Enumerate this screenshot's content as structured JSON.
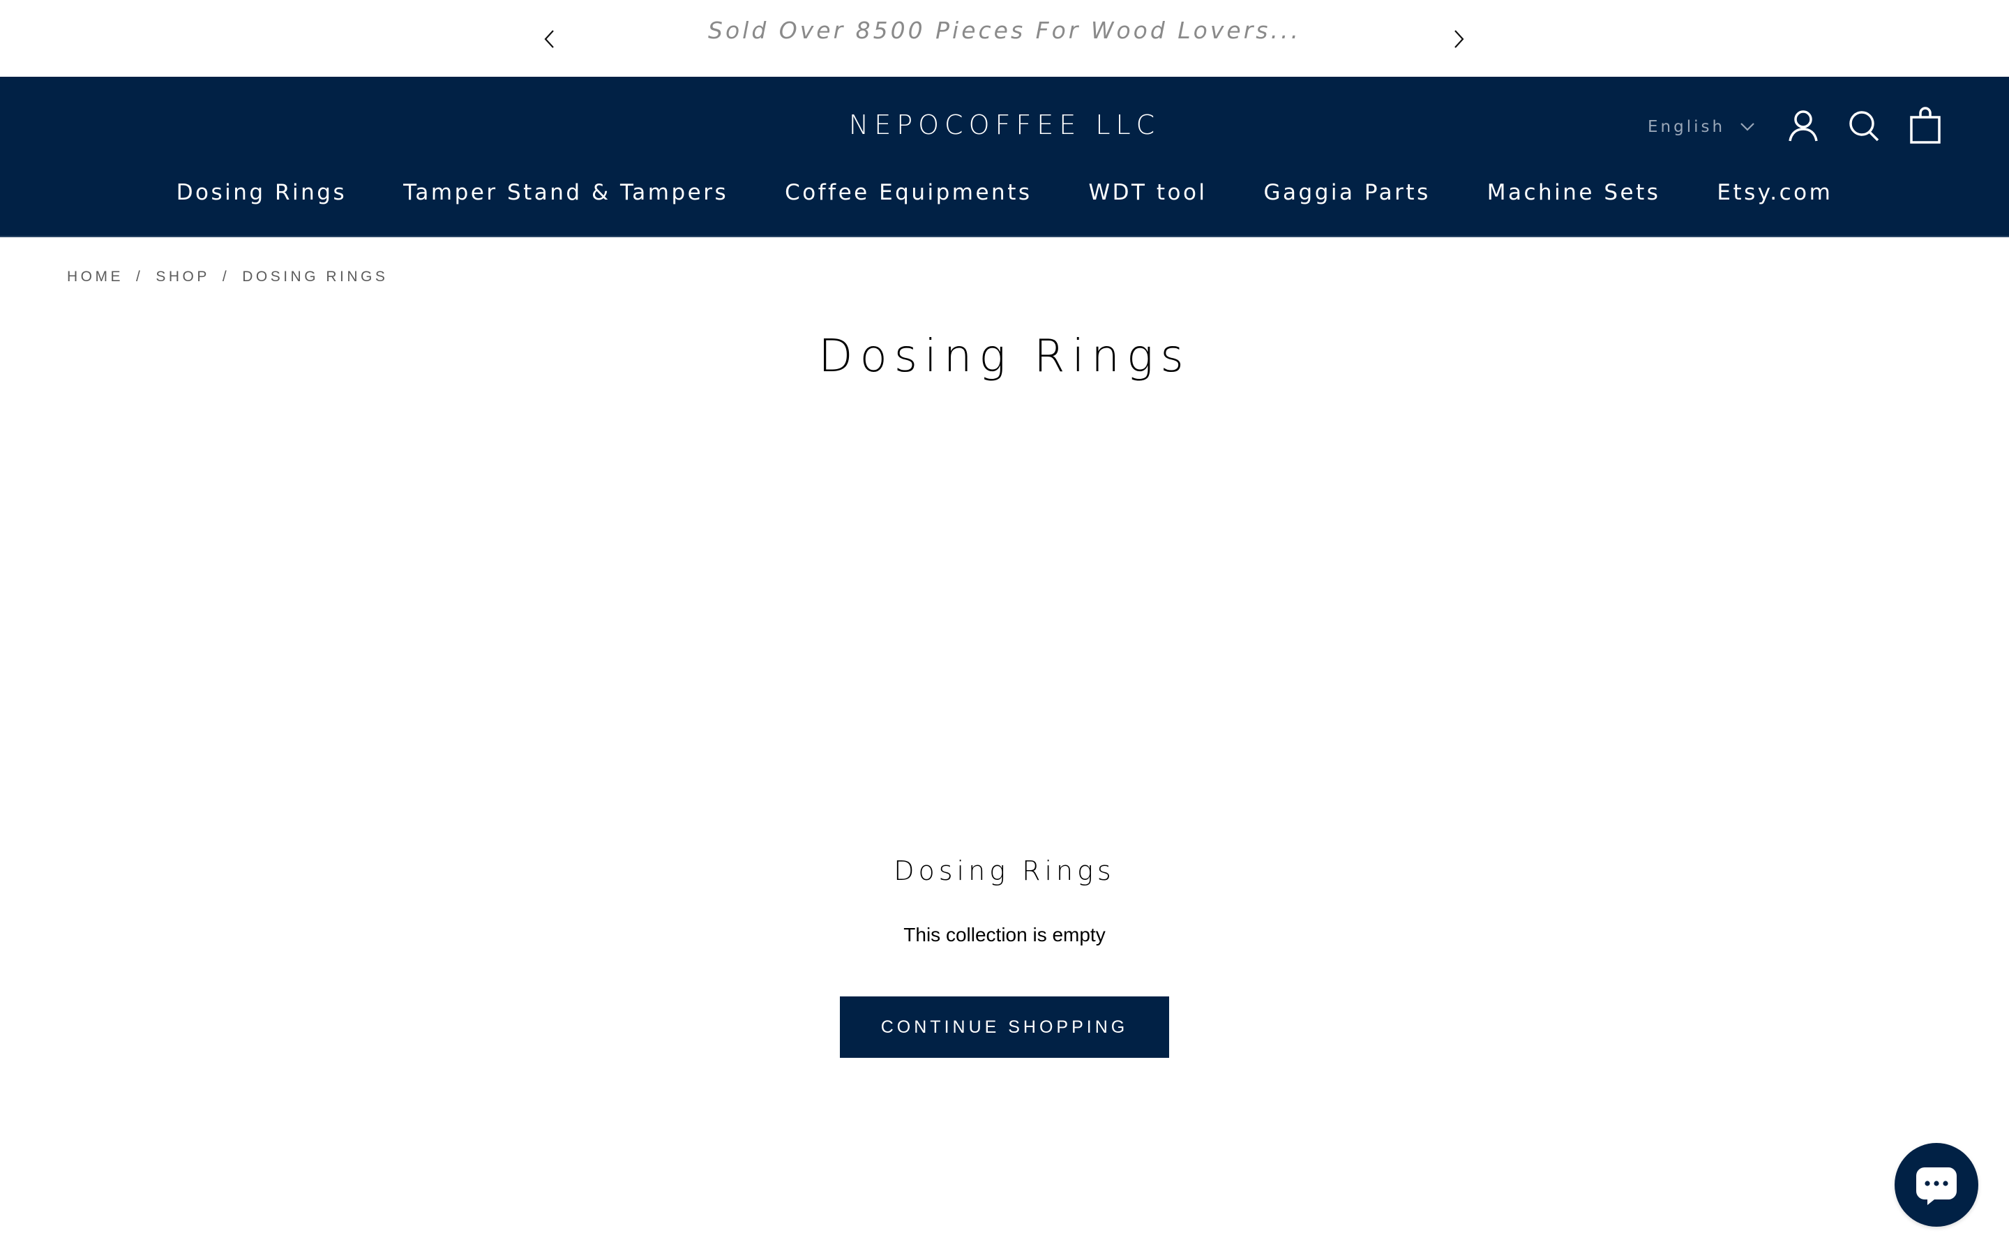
{
  "announcement": {
    "text": "Sold Over 8500 Pieces For Wood Lovers...",
    "prev_icon": "chevron-left-icon",
    "next_icon": "chevron-right-icon"
  },
  "header": {
    "logo": "NEPOCOFFEE LLC",
    "language": "English",
    "icons": [
      "user-icon",
      "search-icon",
      "shopping-bag-icon"
    ],
    "nav": [
      {
        "label": "Dosing Rings"
      },
      {
        "label": "Tamper Stand & Tampers"
      },
      {
        "label": "Coffee Equipments"
      },
      {
        "label": "WDT tool"
      },
      {
        "label": "Gaggia Parts"
      },
      {
        "label": "Machine Sets"
      },
      {
        "label": "Etsy.com"
      }
    ]
  },
  "breadcrumb": {
    "items": [
      "HOME",
      "SHOP",
      "DOSING RINGS"
    ],
    "separator": "/"
  },
  "main": {
    "title": "Dosing Rings",
    "empty_title": "Dosing Rings",
    "empty_text": "This collection is empty",
    "continue_label": "CONTINUE SHOPPING"
  },
  "chat": {
    "icon": "chat-icon"
  },
  "colors": {
    "brand": "#012145",
    "announcement_text": "#8a8a8a",
    "breadcrumb_text": "#5c5c5c",
    "language_text": "#9aa7b8"
  }
}
